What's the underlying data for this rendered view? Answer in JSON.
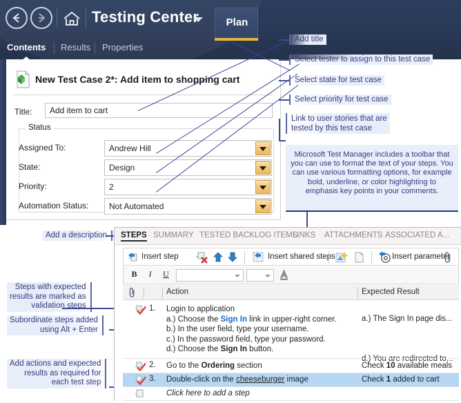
{
  "header": {
    "app_title": "Testing Center",
    "plan_tab": "Plan",
    "back_icon": "back-arrow-icon",
    "forward_icon": "forward-arrow-icon",
    "home_icon": "home-icon",
    "dropdown_icon": "chevron-down-icon",
    "accent_underline_color": "#e0b93c",
    "background_color": "#2a3a58",
    "subtabs": [
      {
        "label": "Contents",
        "active": true
      },
      {
        "label": "Results",
        "active": false
      },
      {
        "label": "Properties",
        "active": false
      }
    ]
  },
  "form": {
    "heading": "New Test Case 2*: Add item to shopping cart",
    "doc_icon": "test-case-document-icon",
    "title_label": "Title:",
    "title_value": "Add item to cart",
    "group_legend": "Status",
    "fields": [
      {
        "label": "Assigned To:",
        "value": "Andrew Hill",
        "dropdown_icon": "dropdown-arrow-icon"
      },
      {
        "label": "State:",
        "value": "Design",
        "dropdown_icon": "dropdown-arrow-icon"
      },
      {
        "label": "Priority:",
        "value": "2",
        "dropdown_icon": "dropdown-arrow-icon"
      },
      {
        "label": "Automation Status:",
        "value": "Not Automated",
        "dropdown_icon": "dropdown-arrow-icon"
      }
    ]
  },
  "annotations": {
    "right": [
      "Add title",
      "Select tester to assign to this test case",
      "Select state for test case",
      "Select priority for test case"
    ],
    "right_multiline_line1": "Link to user stories that are",
    "right_multiline_line2": "tested by this test case",
    "callout": "Microsoft Test Manager includes a toolbar that you can use to format the text of your steps. You can use various formatting options, for example bold, underline, or color highlighting to emphasis key points in your comments.",
    "left": [
      "Add a description",
      "Steps with expected\nresults are marked as\nvalidation steps",
      "Subordinate steps added\nusing Alt + Enter",
      "Add actions and expected\nresults as required for\neach test step"
    ]
  },
  "steps_panel": {
    "tabs": [
      {
        "label": "STEPS",
        "active": true
      },
      {
        "label": "SUMMARY",
        "active": false
      },
      {
        "label": "TESTED BACKLOG ITEMS",
        "active": false
      },
      {
        "label": "LINKS",
        "active": false
      },
      {
        "label": "ATTACHMENTS",
        "active": false
      },
      {
        "label": "ASSOCIATED A...",
        "active": false
      }
    ],
    "toolbar": {
      "insert_step": "Insert step",
      "insert_step_icon": "insert-step-icon",
      "delete_step_icon": "delete-step-icon",
      "move_up_icon": "move-up-arrow-icon",
      "move_down_icon": "move-down-arrow-icon",
      "insert_shared_steps": "Insert shared steps",
      "insert_shared_steps_icon": "insert-shared-steps-icon",
      "create_shared_steps_icon": "create-shared-steps-icon",
      "open_shared_steps_icon": "open-shared-steps-icon",
      "insert_parameter": "Insert parameter",
      "insert_parameter_icon": "insert-parameter-icon",
      "attachment_icon": "paperclip-icon"
    },
    "format_toolbar": {
      "bold": "B",
      "italic": "I",
      "underline": "U",
      "font_family_value": "",
      "font_size_value": "",
      "font_color_icon": "font-color-icon"
    },
    "grid": {
      "attachment_col_icon": "paperclip-icon",
      "columns": [
        "Action",
        "Expected Result"
      ],
      "add_step_placeholder": "Click here to add a step",
      "add_step_icon": "new-step-icon",
      "rows": [
        {
          "number": "1.",
          "icon": "validation-step-icon",
          "action_lines": [
            "Login to application",
            "a.) Choose the Sign In link in upper-right corner.",
            "b.) In the user field, type your username.",
            "c.) In the password field, type your password.",
            "d.) Choose the Sign In button."
          ],
          "expected_lines": [
            "a.) The Sign In page dis...",
            "d.) You are redirected to..."
          ],
          "selected": false
        },
        {
          "number": "2.",
          "icon": "validation-step-icon",
          "action": "Go to the Ordering section",
          "expected": "Check 10 available meals",
          "selected": false
        },
        {
          "number": "3.",
          "icon": "validation-step-icon",
          "action": "Double-click on the cheeseburger image",
          "expected": "Check 1 added to cart",
          "selected": true
        }
      ]
    }
  }
}
